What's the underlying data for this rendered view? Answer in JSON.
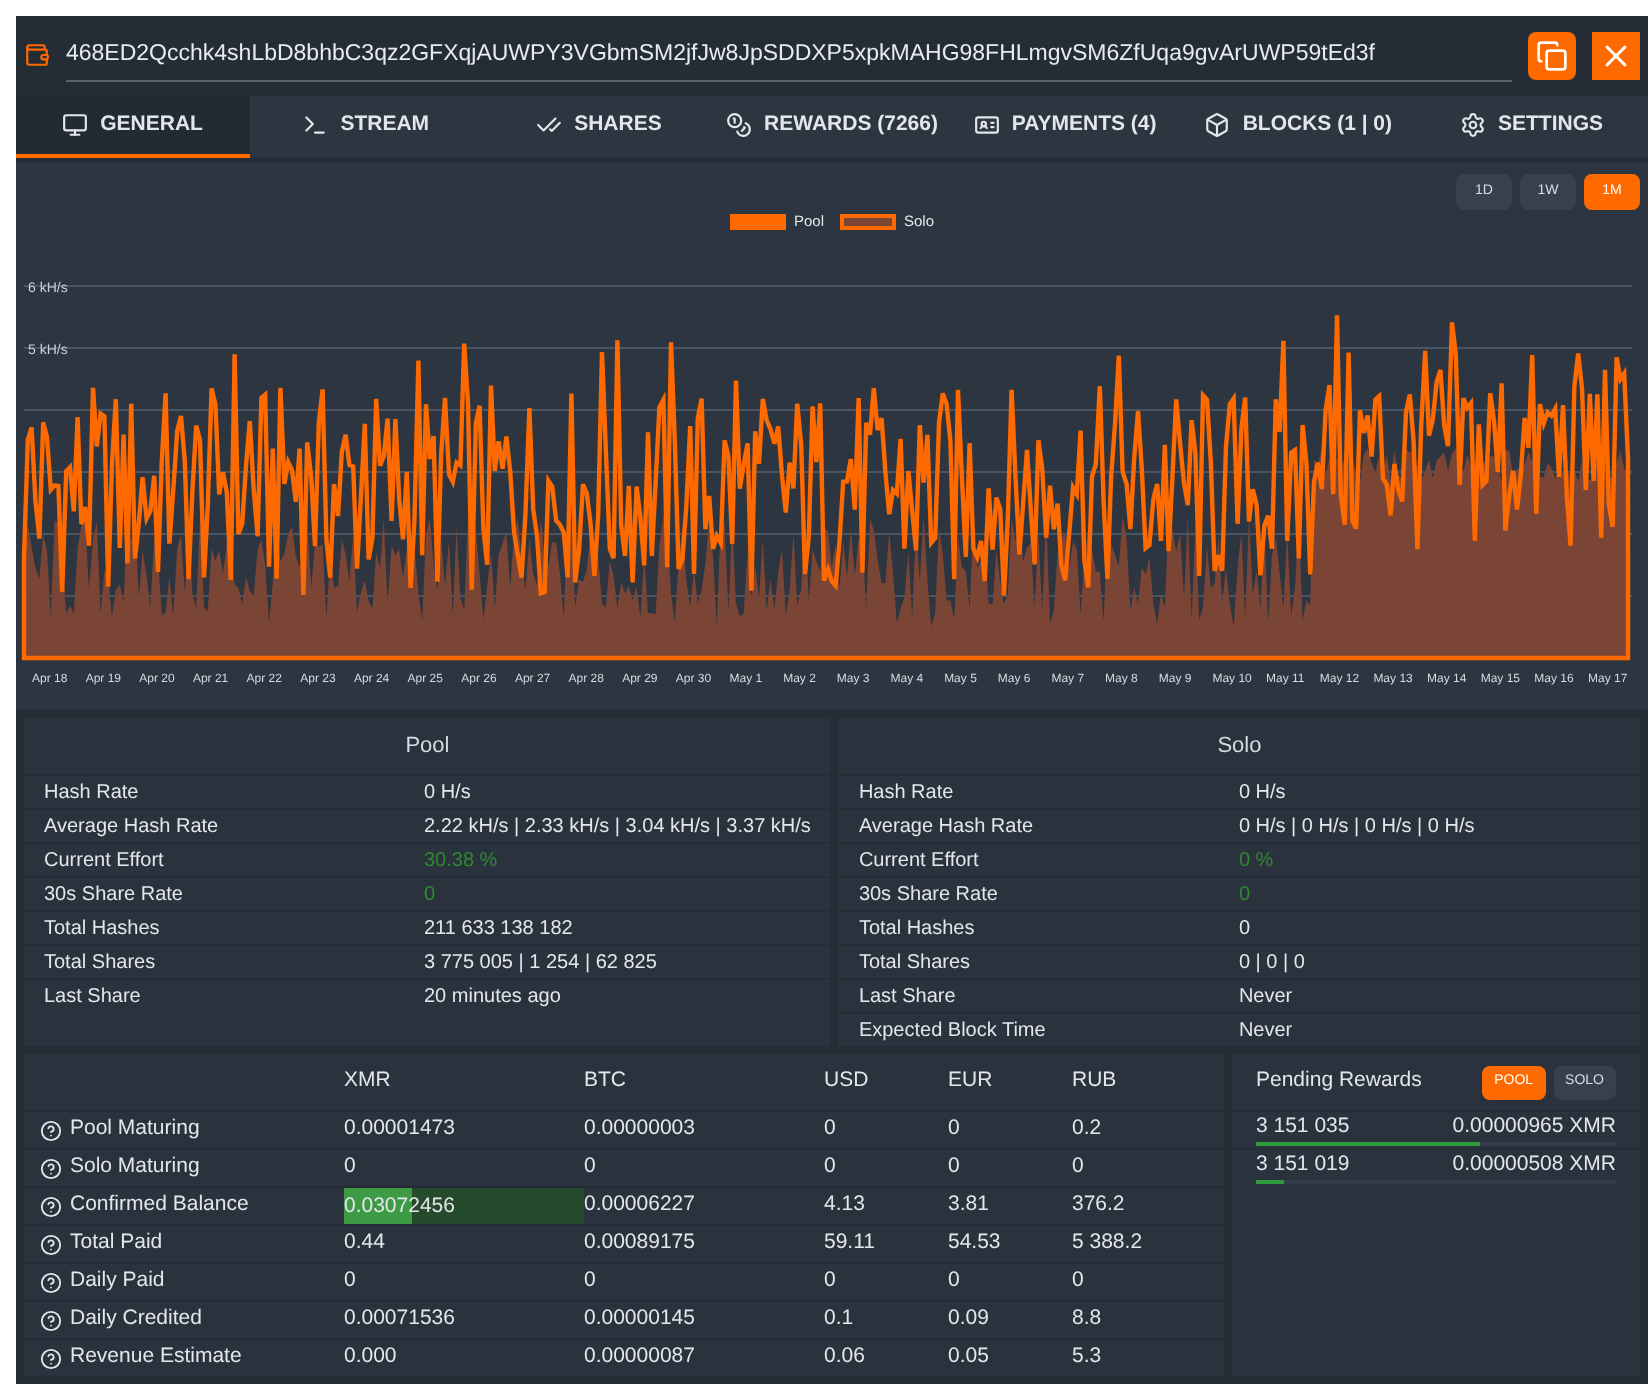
{
  "address_bar": {
    "address": "468ED2Qcchk4shLbD8bhbC3qz2GFXqjAUWPY3VGbmSM2jfJw8JpSDDXP5xpkMAHG98FHLmgvSM6ZfUqa9gvArUWP59tEd3f"
  },
  "tabs": [
    {
      "label": "GENERAL",
      "selected": true
    },
    {
      "label": "STREAM",
      "selected": false
    },
    {
      "label": "SHARES",
      "selected": false
    },
    {
      "label": "REWARDS (7266)",
      "selected": false
    },
    {
      "label": "PAYMENTS (4)",
      "selected": false
    },
    {
      "label": "BLOCKS (1 | 0)",
      "selected": false
    },
    {
      "label": "SETTINGS",
      "selected": false
    }
  ],
  "range_buttons": [
    {
      "label": "1D",
      "selected": false
    },
    {
      "label": "1W",
      "selected": false
    },
    {
      "label": "1M",
      "selected": true
    }
  ],
  "chart": {
    "legend": [
      {
        "label": "Pool",
        "color": "#ff6a00"
      },
      {
        "label": "Solo",
        "color": "#7a4535"
      }
    ],
    "yticks": [
      "6 kH/s",
      "5 kH/s"
    ],
    "xlabels": [
      "Apr 18",
      "Apr 19",
      "Apr 20",
      "Apr 21",
      "Apr 22",
      "Apr 23",
      "Apr 24",
      "Apr 25",
      "Apr 26",
      "Apr 27",
      "Apr 28",
      "Apr 29",
      "Apr 30",
      "May 1",
      "May 2",
      "May 3",
      "May 4",
      "May 5",
      "May 6",
      "May 7",
      "May 8",
      "May 9",
      "May 10",
      "May 11",
      "May 12",
      "May 13",
      "May 14",
      "May 15",
      "May 16",
      "May 17"
    ]
  },
  "stats": [
    {
      "title": "Pool",
      "rows": [
        {
          "label": "Hash Rate",
          "value": "0 H/s",
          "positive": false
        },
        {
          "label": "Average Hash Rate",
          "value": "2.22 kH/s | 2.33 kH/s | 3.04 kH/s | 3.37 kH/s",
          "positive": false
        },
        {
          "label": "Current Effort",
          "value": "30.38 %",
          "positive": true
        },
        {
          "label": "30s Share Rate",
          "value": "0",
          "positive": true
        },
        {
          "label": "Total Hashes",
          "value": "211 633 138 182",
          "positive": false
        },
        {
          "label": "Total Shares",
          "value": "3 775 005 | 1 254 | 62 825",
          "positive": false
        },
        {
          "label": "Last Share",
          "value": "20 minutes ago",
          "positive": false
        }
      ]
    },
    {
      "title": "Solo",
      "rows": [
        {
          "label": "Hash Rate",
          "value": "0 H/s",
          "positive": false
        },
        {
          "label": "Average Hash Rate",
          "value": "0 H/s | 0 H/s | 0 H/s | 0 H/s",
          "positive": false
        },
        {
          "label": "Current Effort",
          "value": "0 %",
          "positive": true
        },
        {
          "label": "30s Share Rate",
          "value": "0",
          "positive": true
        },
        {
          "label": "Total Hashes",
          "value": "0",
          "positive": false
        },
        {
          "label": "Total Shares",
          "value": "0 | 0 | 0",
          "positive": false
        },
        {
          "label": "Last Share",
          "value": "Never",
          "positive": false
        },
        {
          "label": "Expected Block Time",
          "value": "Never",
          "positive": false
        }
      ]
    }
  ],
  "balances": {
    "columns": [
      "XMR",
      "BTC",
      "USD",
      "EUR",
      "RUB"
    ],
    "rows": [
      {
        "label": "Pool Maturing",
        "values": [
          "0.00001473",
          "0.00000003",
          "0",
          "0",
          "0.2"
        ]
      },
      {
        "label": "Solo Maturing",
        "values": [
          "0",
          "0",
          "0",
          "0",
          "0"
        ]
      },
      {
        "label": "Confirmed Balance",
        "values": [
          "0.03072456",
          "0.00006227",
          "4.13",
          "3.81",
          "376.2"
        ],
        "level": 0.28
      },
      {
        "label": "Total Paid",
        "values": [
          "0.44",
          "0.00089175",
          "59.11",
          "54.53",
          "5 388.2"
        ]
      },
      {
        "label": "Daily Paid",
        "values": [
          "0",
          "0",
          "0",
          "0",
          "0"
        ]
      },
      {
        "label": "Daily Credited",
        "values": [
          "0.00071536",
          "0.00000145",
          "0.1",
          "0.09",
          "8.8"
        ]
      },
      {
        "label": "Revenue Estimate",
        "values": [
          "0.000",
          "0.00000087",
          "0.06",
          "0.05",
          "5.3"
        ]
      }
    ]
  },
  "pending": {
    "title": "Pending Rewards",
    "toggles": [
      {
        "label": "POOL",
        "selected": true
      },
      {
        "label": "SOLO",
        "selected": false
      }
    ],
    "rows": [
      {
        "height": "3 151 035",
        "amount": "0.00000965 XMR",
        "level": 0.62
      },
      {
        "height": "3 151 019",
        "amount": "0.00000508 XMR",
        "level": 0.08
      }
    ]
  }
}
